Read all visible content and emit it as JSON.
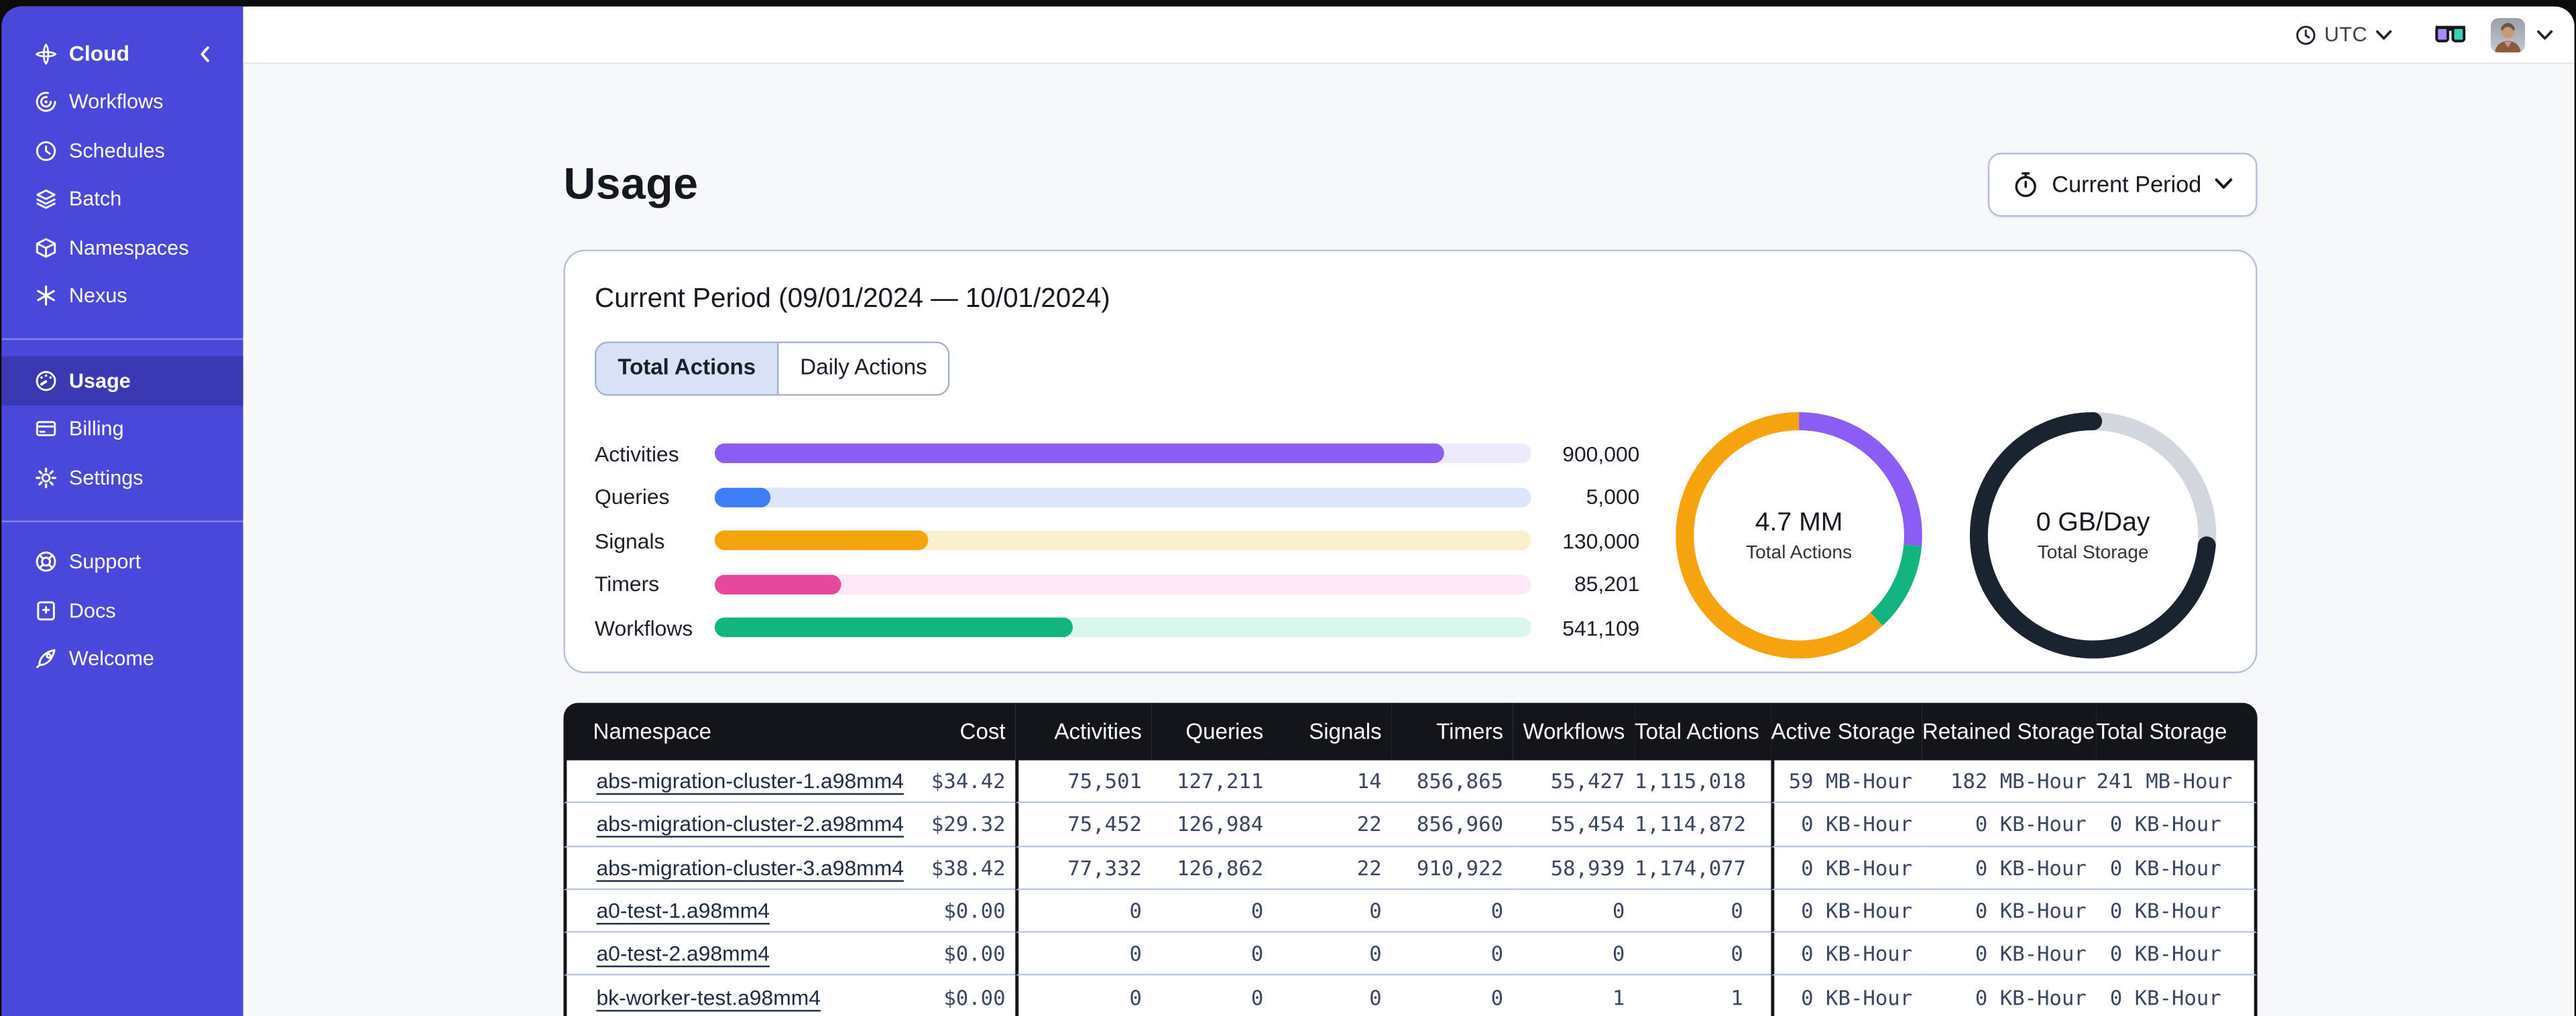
{
  "sidebar": {
    "groups": [
      {
        "items": [
          {
            "label": "Cloud",
            "icon": "temporal-cloud-icon"
          },
          {
            "label": "Workflows",
            "icon": "workflows-icon"
          },
          {
            "label": "Schedules",
            "icon": "schedules-icon"
          },
          {
            "label": "Batch",
            "icon": "batch-icon"
          },
          {
            "label": "Namespaces",
            "icon": "namespaces-icon"
          },
          {
            "label": "Nexus",
            "icon": "nexus-icon"
          }
        ]
      },
      {
        "items": [
          {
            "label": "Usage",
            "icon": "usage-icon",
            "active": true
          },
          {
            "label": "Billing",
            "icon": "billing-icon"
          },
          {
            "label": "Settings",
            "icon": "settings-icon"
          }
        ]
      },
      {
        "items": [
          {
            "label": "Support",
            "icon": "support-icon"
          },
          {
            "label": "Docs",
            "icon": "docs-icon"
          },
          {
            "label": "Welcome",
            "icon": "welcome-icon"
          }
        ]
      }
    ]
  },
  "topbar": {
    "timezone": "UTC"
  },
  "page": {
    "title": "Usage",
    "period_button_label": "Current Period"
  },
  "card": {
    "title": "Current Period (09/01/2024 — 10/01/2024)",
    "tabs": [
      {
        "label": "Total Actions",
        "active": true
      },
      {
        "label": "Daily Actions",
        "active": false
      }
    ]
  },
  "chart_data": [
    {
      "type": "bar",
      "orientation": "horizontal",
      "title": "Current Period (09/01/2024 — 10/01/2024)",
      "categories": [
        "Activities",
        "Queries",
        "Signals",
        "Timers",
        "Workflows"
      ],
      "values": [
        900000,
        5000,
        130000,
        85201,
        541109
      ],
      "value_labels": [
        "900,000",
        "5,000",
        "130,000",
        "85,201",
        "541,109"
      ],
      "fill_percents": [
        89.3,
        6.8,
        26.1,
        15.4,
        43.9
      ],
      "colors": [
        "#8B5CF6",
        "#3F7DF6",
        "#F5A40D",
        "#E8489B",
        "#12B57F"
      ],
      "track_colors": [
        "#EEE8FC",
        "#DCE7FB",
        "#FBF0CE",
        "#FDE9F5",
        "#D9F7EA"
      ]
    },
    {
      "type": "pie",
      "variant": "donut",
      "center_value": "4.7 MM",
      "center_label": "Total Actions",
      "segments": [
        {
          "color": "#8B5CF6",
          "percent": 26.4
        },
        {
          "color": "#12B57F",
          "percent": 11.7
        },
        {
          "color": "#F5A40D",
          "percent": 61.9
        }
      ],
      "rounded_caps": false
    },
    {
      "type": "pie",
      "variant": "donut",
      "center_value": "0 GB/Day",
      "center_label": "Total Storage",
      "segments": [
        {
          "color": "#D2D7DE",
          "percent": 26.4
        },
        {
          "color": "#1A2330",
          "percent": 73.6
        }
      ],
      "rounded_caps": true
    }
  ],
  "table": {
    "columns": [
      "Namespace",
      "Cost",
      "Activities",
      "Queries",
      "Signals",
      "Timers",
      "Workflows",
      "Total Actions",
      "Active Storage",
      "Retained Storage",
      "Total Storage"
    ],
    "rows": [
      [
        "abs-migration-cluster-1.a98mm4",
        "$34.42",
        "75,501",
        "127,211",
        "14",
        "856,865",
        "55,427",
        "1,115,018",
        "59 MB-Hour",
        "182 MB-Hour",
        "241 MB-Hour"
      ],
      [
        "abs-migration-cluster-2.a98mm4",
        "$29.32",
        "75,452",
        "126,984",
        "22",
        "856,960",
        "55,454",
        "1,114,872",
        "0 KB-Hour",
        "0 KB-Hour",
        "0 KB-Hour"
      ],
      [
        "abs-migration-cluster-3.a98mm4",
        "$38.42",
        "77,332",
        "126,862",
        "22",
        "910,922",
        "58,939",
        "1,174,077",
        "0 KB-Hour",
        "0 KB-Hour",
        "0 KB-Hour"
      ],
      [
        "a0-test-1.a98mm4",
        "$0.00",
        "0",
        "0",
        "0",
        "0",
        "0",
        "0",
        "0 KB-Hour",
        "0 KB-Hour",
        "0 KB-Hour"
      ],
      [
        "a0-test-2.a98mm4",
        "$0.00",
        "0",
        "0",
        "0",
        "0",
        "0",
        "0",
        "0 KB-Hour",
        "0 KB-Hour",
        "0 KB-Hour"
      ],
      [
        "bk-worker-test.a98mm4",
        "$0.00",
        "0",
        "0",
        "0",
        "0",
        "1",
        "1",
        "0 KB-Hour",
        "0 KB-Hour",
        "0 KB-Hour"
      ]
    ]
  }
}
